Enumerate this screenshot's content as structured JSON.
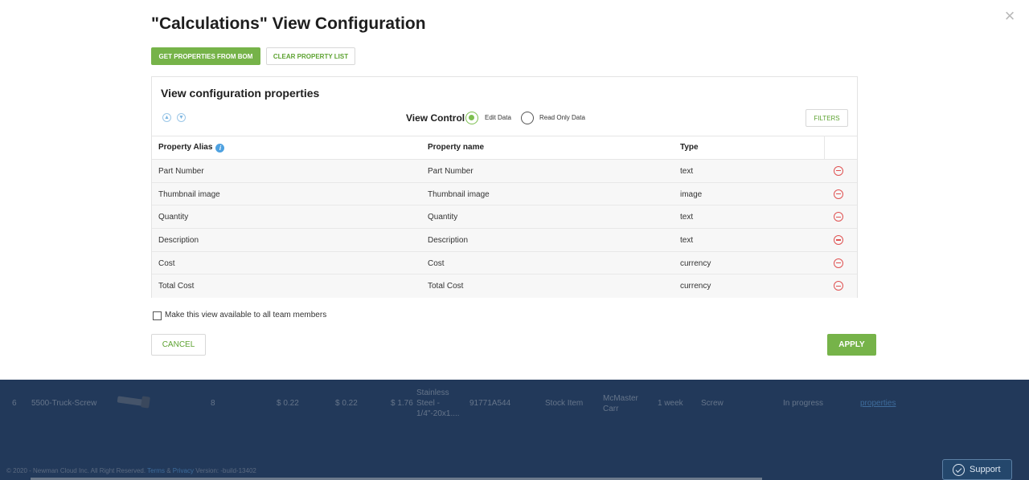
{
  "modal": {
    "title": "\"Calculations\" View Configuration",
    "get_props_button": "GET PROPERTIES FROM BOM",
    "clear_list_button": "CLEAR PROPERTY LIST",
    "close_icon": "close-icon"
  },
  "panel": {
    "title": "View configuration properties",
    "view_control_label": "View Control",
    "radio_edit": "Edit Data",
    "radio_read_only": "Read Only Data",
    "selected_radio": "Edit Data",
    "filters_button": "FILTERS"
  },
  "table": {
    "headers": [
      "Property Alias",
      "Property name",
      "Type"
    ],
    "rows": [
      {
        "alias": "Part Number",
        "name": "Part Number",
        "type": "text"
      },
      {
        "alias": "Thumbnail image",
        "name": "Thumbnail image",
        "type": "image"
      },
      {
        "alias": "Quantity",
        "name": "Quantity",
        "type": "text"
      },
      {
        "alias": "Description",
        "name": "Description",
        "type": "text"
      },
      {
        "alias": "Cost",
        "name": "Cost",
        "type": "currency"
      },
      {
        "alias": "Total Cost",
        "name": "Total Cost",
        "type": "currency"
      }
    ]
  },
  "footer": {
    "checkbox_label": "Make this view available to all team members",
    "checkbox_checked": false,
    "cancel_button": "CANCEL",
    "apply_button": "APPLY"
  },
  "background": {
    "row": {
      "index": "6",
      "part": "5500-Truck-Screw",
      "qty": "8",
      "cost": "$ 0.22",
      "cost2": "$ 0.22",
      "total": "$ 1.76",
      "desc_1": "Stainless",
      "desc_2": "Steel -",
      "desc_3": "1/4\"-20x1....",
      "pn": "91771A544",
      "stock": "Stock Item",
      "vendor_1": "McMaster",
      "vendor_2": "Carr",
      "lead": "1 week",
      "category": "Screw",
      "status": "In progress",
      "link": "properties"
    },
    "footer": {
      "copyright": "© 2020 - Newman Cloud Inc. All Right Reserved.",
      "terms": "Terms",
      "amp": "&",
      "privacy": "Privacy",
      "version": "Version: -build-13402"
    },
    "support": "Support"
  }
}
